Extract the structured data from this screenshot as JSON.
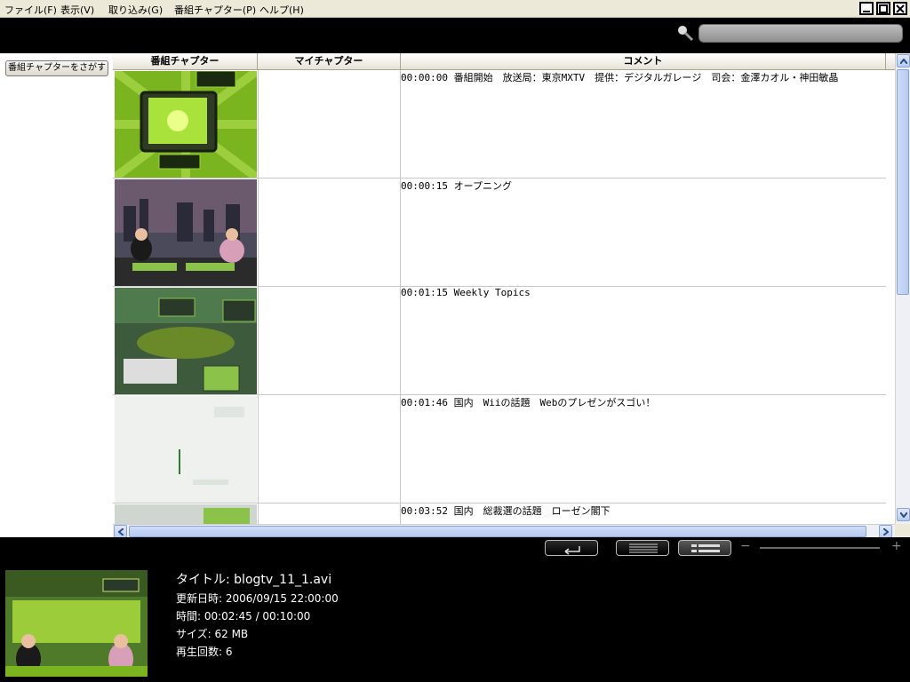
{
  "menu": [
    "ファイル(F)",
    "表示(V)",
    "取り込み(G)",
    "番組チャプター(P)",
    "ヘルプ(H)"
  ],
  "search": {
    "placeholder": ""
  },
  "left_panel": {
    "find_button": "番組チャプターをさがす"
  },
  "table": {
    "headers": [
      "番組チャプター",
      "マイチャプター",
      "コメント"
    ],
    "rows": [
      {
        "thumb": "tv-set-on-green",
        "comment": "00:00:00 番組開始　放送局：東京MXTV　提供：デジタルガレージ　司会：金澤カオル・神田敏晶"
      },
      {
        "thumb": "studio-two-hosts",
        "comment": "00:00:15 オープニング"
      },
      {
        "thumb": "weekly-topics-set",
        "comment": "00:01:15 Weekly Topics"
      },
      {
        "thumb": "white-screen",
        "comment": "00:01:46 国内　Wiiの話題　Webのプレゼンがスゴい！"
      },
      {
        "thumb": "partial",
        "comment": "00:03:52 国内　総裁選の話題　ローゼン閣下"
      }
    ]
  },
  "info": {
    "title": "タイトル: blogtv_11_1.avi",
    "updated": "更新日時: 2006/09/15 22:00:00",
    "time": "時間: 00:02:45 / 00:10:00",
    "size": "サイズ: 62 MB",
    "plays": "再生回数: 6"
  },
  "colors": {
    "accent": "#8bc34a",
    "scroll": "#b6c9f0"
  }
}
